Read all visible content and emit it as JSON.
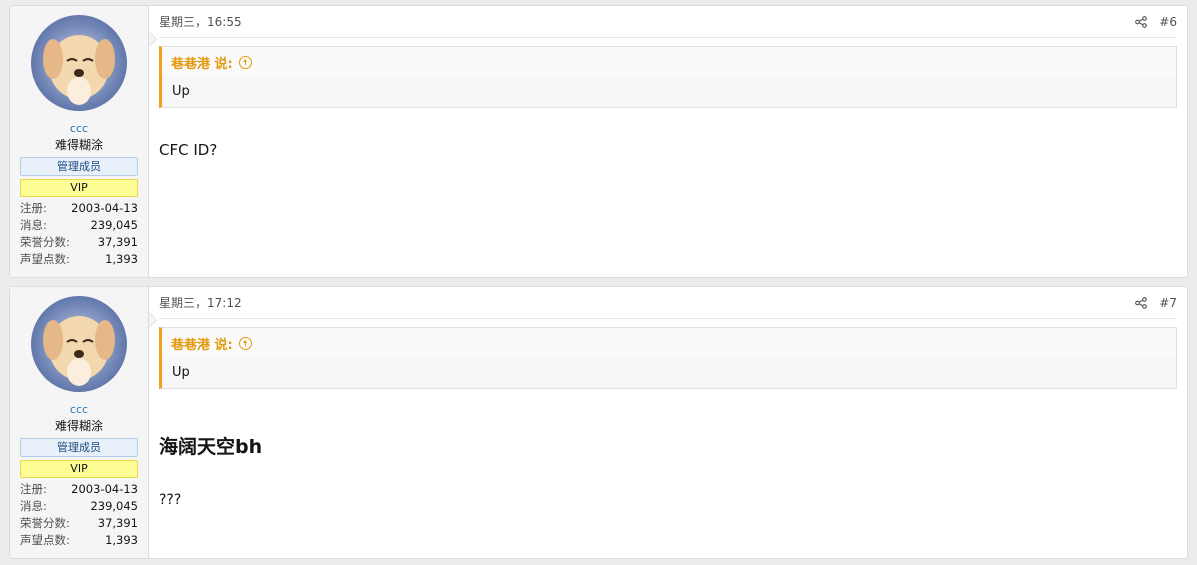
{
  "posts": [
    {
      "user": {
        "name": "ccc",
        "title": "难得糊涂",
        "staff_badge": "管理成员",
        "vip_badge": "VIP",
        "stats": [
          {
            "label": "注册:",
            "value": "2003-04-13"
          },
          {
            "label": "消息:",
            "value": "239,045"
          },
          {
            "label": "荣誉分数:",
            "value": "37,391"
          },
          {
            "label": "声望点数:",
            "value": "1,393"
          }
        ]
      },
      "time": "星期三，16:55",
      "number": "#6",
      "quote": {
        "author": "巷巷港 说:",
        "text": "Up"
      },
      "body": "CFC ID?"
    },
    {
      "user": {
        "name": "ccc",
        "title": "难得糊涂",
        "staff_badge": "管理成员",
        "vip_badge": "VIP",
        "stats": [
          {
            "label": "注册:",
            "value": "2003-04-13"
          },
          {
            "label": "消息:",
            "value": "239,045"
          },
          {
            "label": "荣誉分数:",
            "value": "37,391"
          },
          {
            "label": "声望点数:",
            "value": "1,393"
          }
        ]
      },
      "time": "星期三，17:12",
      "number": "#7",
      "quote": {
        "author": "巷巷港 说:",
        "text": "Up"
      },
      "body_heading": "海阔天空bh",
      "body": "???"
    }
  ],
  "icons": {
    "share": "share-icon",
    "quote_up": "arrow-up-circle-icon",
    "avatar": "puppy-avatar"
  },
  "colors": {
    "quote_accent": "#e29a0c",
    "username": "#2577b1",
    "vip": "#fdfd96"
  }
}
